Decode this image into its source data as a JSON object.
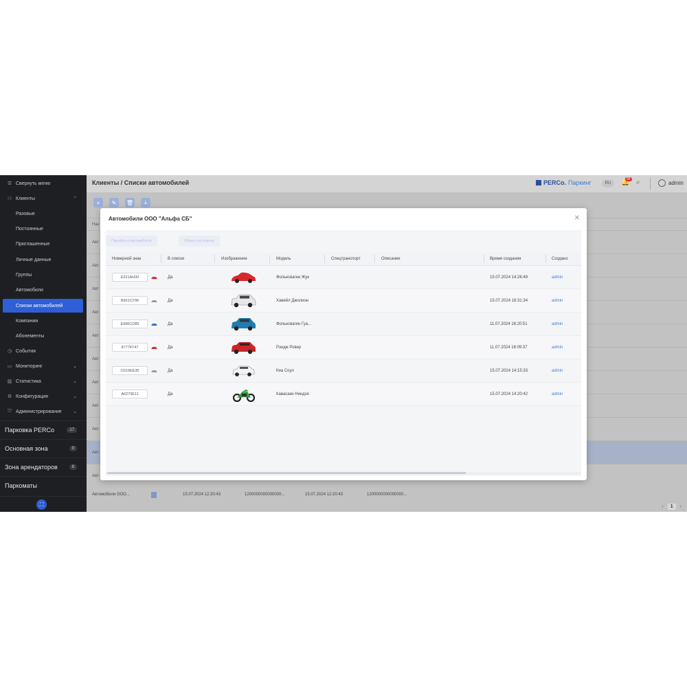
{
  "sidebar": {
    "collapse_label": "Свернуть меню",
    "clients_label": "Клиенты",
    "sub_items": [
      "Разовые",
      "Постоянные",
      "Приглашенные",
      "Личные данные",
      "Группы",
      "Автомобили",
      "Списки автомобилей",
      "Компании",
      "Абонементы"
    ],
    "active_item": "Списки автомобилей",
    "sections": [
      "События",
      "Мониторинг",
      "Статистика",
      "Конфигурация",
      "Администрирование"
    ],
    "zones": [
      {
        "label": "Парковка PERCo",
        "badge": "17"
      },
      {
        "label": "Основная зона",
        "badge": "9"
      },
      {
        "label": "Зона арендаторов",
        "badge": "8"
      },
      {
        "label": "Паркоматы",
        "badge": ""
      }
    ]
  },
  "header": {
    "breadcrumb": "Клиенты / Списки автомобилей",
    "brand_name": "PERCo.",
    "brand_product": "Паркинг",
    "lang": "RU",
    "notifications": "99",
    "user": "admin"
  },
  "background": {
    "row_prefix": "Авт",
    "header_prefix": "Наз",
    "last_row": {
      "name": "Автомобили ООО...",
      "created": "15.07.2024 12:20:43",
      "id1": "1200000000000000...",
      "modified": "15.07.2024 12:20:43",
      "id2": "1200000000000000..."
    },
    "pager_current": "1"
  },
  "modal": {
    "title": "Автомобили ООО \"Альфа СБ\"",
    "btn_goto": "Перейти к автомобилю",
    "btn_remove": "Убрать из списка",
    "columns": [
      "Номерной знак",
      "В списке",
      "Изображение",
      "Модель",
      "Спецтранспорт",
      "Описание",
      "Время создания",
      "Создано"
    ],
    "rows": [
      {
        "plate": "Е221АН30",
        "in_list": "Да",
        "model": "Фольксваген Жук",
        "special": "",
        "description": "",
        "created": "15.07.2024 14:26:49",
        "creator": "admin",
        "car_color": "#d9282c",
        "icon_color": "#d9282c"
      },
      {
        "plate": "В661СУ96",
        "in_list": "Да",
        "model": "Хавейл Джолион",
        "special": "",
        "description": "",
        "created": "15.07.2024 18:31:34",
        "creator": "admin",
        "car_color": "#e9eaec",
        "icon_color": "#9a9a9a"
      },
      {
        "plate": "Е996СО85",
        "in_list": "Да",
        "model": "Фольксваген Гуа...",
        "special": "",
        "description": "",
        "created": "11.07.2024 16:20:51",
        "creator": "admin",
        "car_color": "#1f7bb0",
        "icon_color": "#2f6fc4"
      },
      {
        "plate": "К777КТ47",
        "in_list": "Да",
        "model": "Рэндж Ровер",
        "special": "",
        "description": "",
        "created": "11.07.2024 16:09:37",
        "creator": "admin",
        "car_color": "#c8262b",
        "icon_color": "#d9282c"
      },
      {
        "plate": "О319ЕЕ35",
        "in_list": "Да",
        "model": "Киа Соул",
        "special": "",
        "description": "",
        "created": "15.07.2024 14:15:33",
        "creator": "admin",
        "car_color": "#f3f3f3",
        "icon_color": "#9a9a9a"
      },
      {
        "plate": "А6270Е11",
        "in_list": "Да",
        "model": "Кавасаки Ниндзя",
        "special": "",
        "description": "",
        "created": "15.07.2024 14:20:42",
        "creator": "admin",
        "car_color": "#2f9a3a",
        "icon_color": ""
      }
    ]
  }
}
